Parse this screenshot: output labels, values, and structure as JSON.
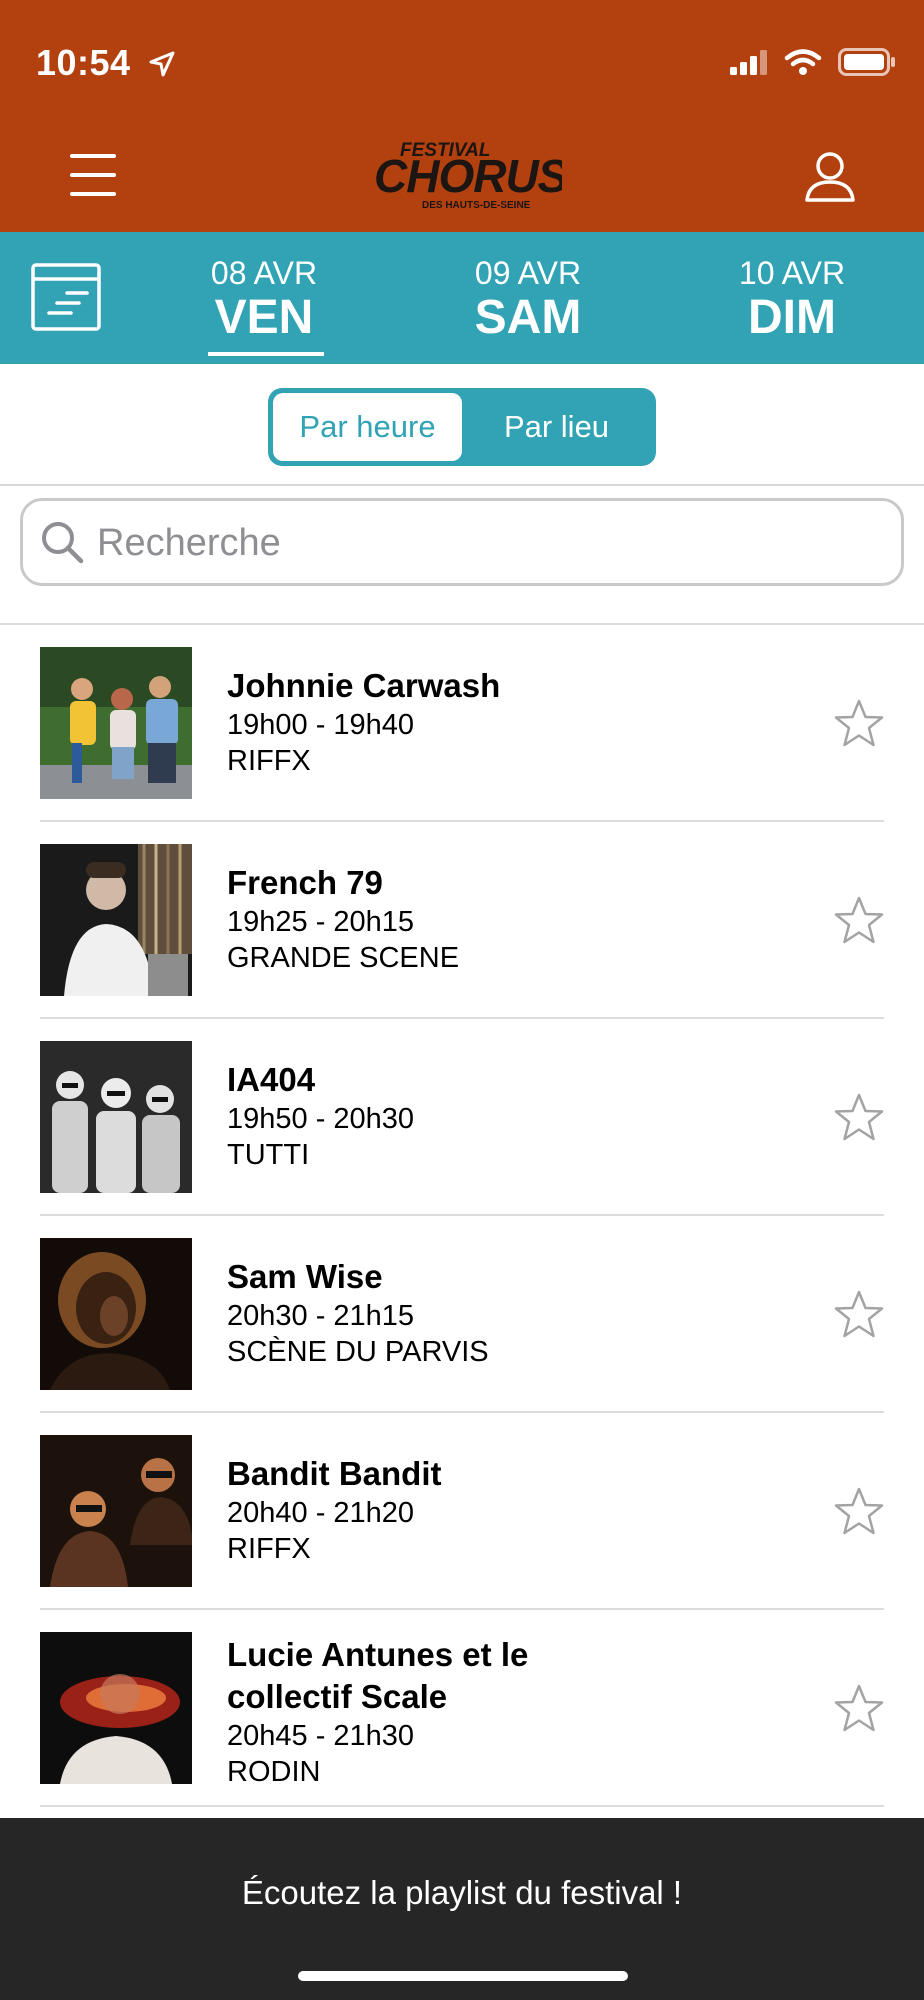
{
  "status_bar": {
    "time": "10:54"
  },
  "header": {
    "logo": {
      "top": "FESTIVAL",
      "main": "CHORUS",
      "sub": "DES HAUTS-DE-SEINE"
    }
  },
  "days": [
    {
      "date": "08 AVR",
      "name": "VEN",
      "active": true
    },
    {
      "date": "09 AVR",
      "name": "SAM",
      "active": false
    },
    {
      "date": "10 AVR",
      "name": "DIM",
      "active": false
    }
  ],
  "segment": {
    "by_hour": "Par heure",
    "by_venue": "Par lieu",
    "selected": "by_hour"
  },
  "search": {
    "placeholder": "Recherche",
    "value": ""
  },
  "events": [
    {
      "artist": "Johnnie Carwash",
      "time": "19h00 - 19h40",
      "venue": "RIFFX",
      "favorite": false
    },
    {
      "artist": "French 79",
      "time": "19h25 - 20h15",
      "venue": "GRANDE SCENE",
      "favorite": false
    },
    {
      "artist": "IA404",
      "time": "19h50 - 20h30",
      "venue": "TUTTI",
      "favorite": false
    },
    {
      "artist": "Sam Wise",
      "time": "20h30 - 21h15",
      "venue": "SCÈNE DU PARVIS",
      "favorite": false
    },
    {
      "artist": "Bandit Bandit",
      "time": "20h40 - 21h20",
      "venue": "RIFFX",
      "favorite": false
    },
    {
      "artist_line1": "Lucie Antunes et le",
      "artist_line2": "collectif Scale",
      "time": "20h45 - 21h30",
      "venue": "RODIN",
      "favorite": false
    }
  ],
  "banner": {
    "text": "Écoutez la playlist du festival !"
  },
  "colors": {
    "header": "#b2410f",
    "accent": "#31a3b4",
    "banner": "#262626"
  }
}
